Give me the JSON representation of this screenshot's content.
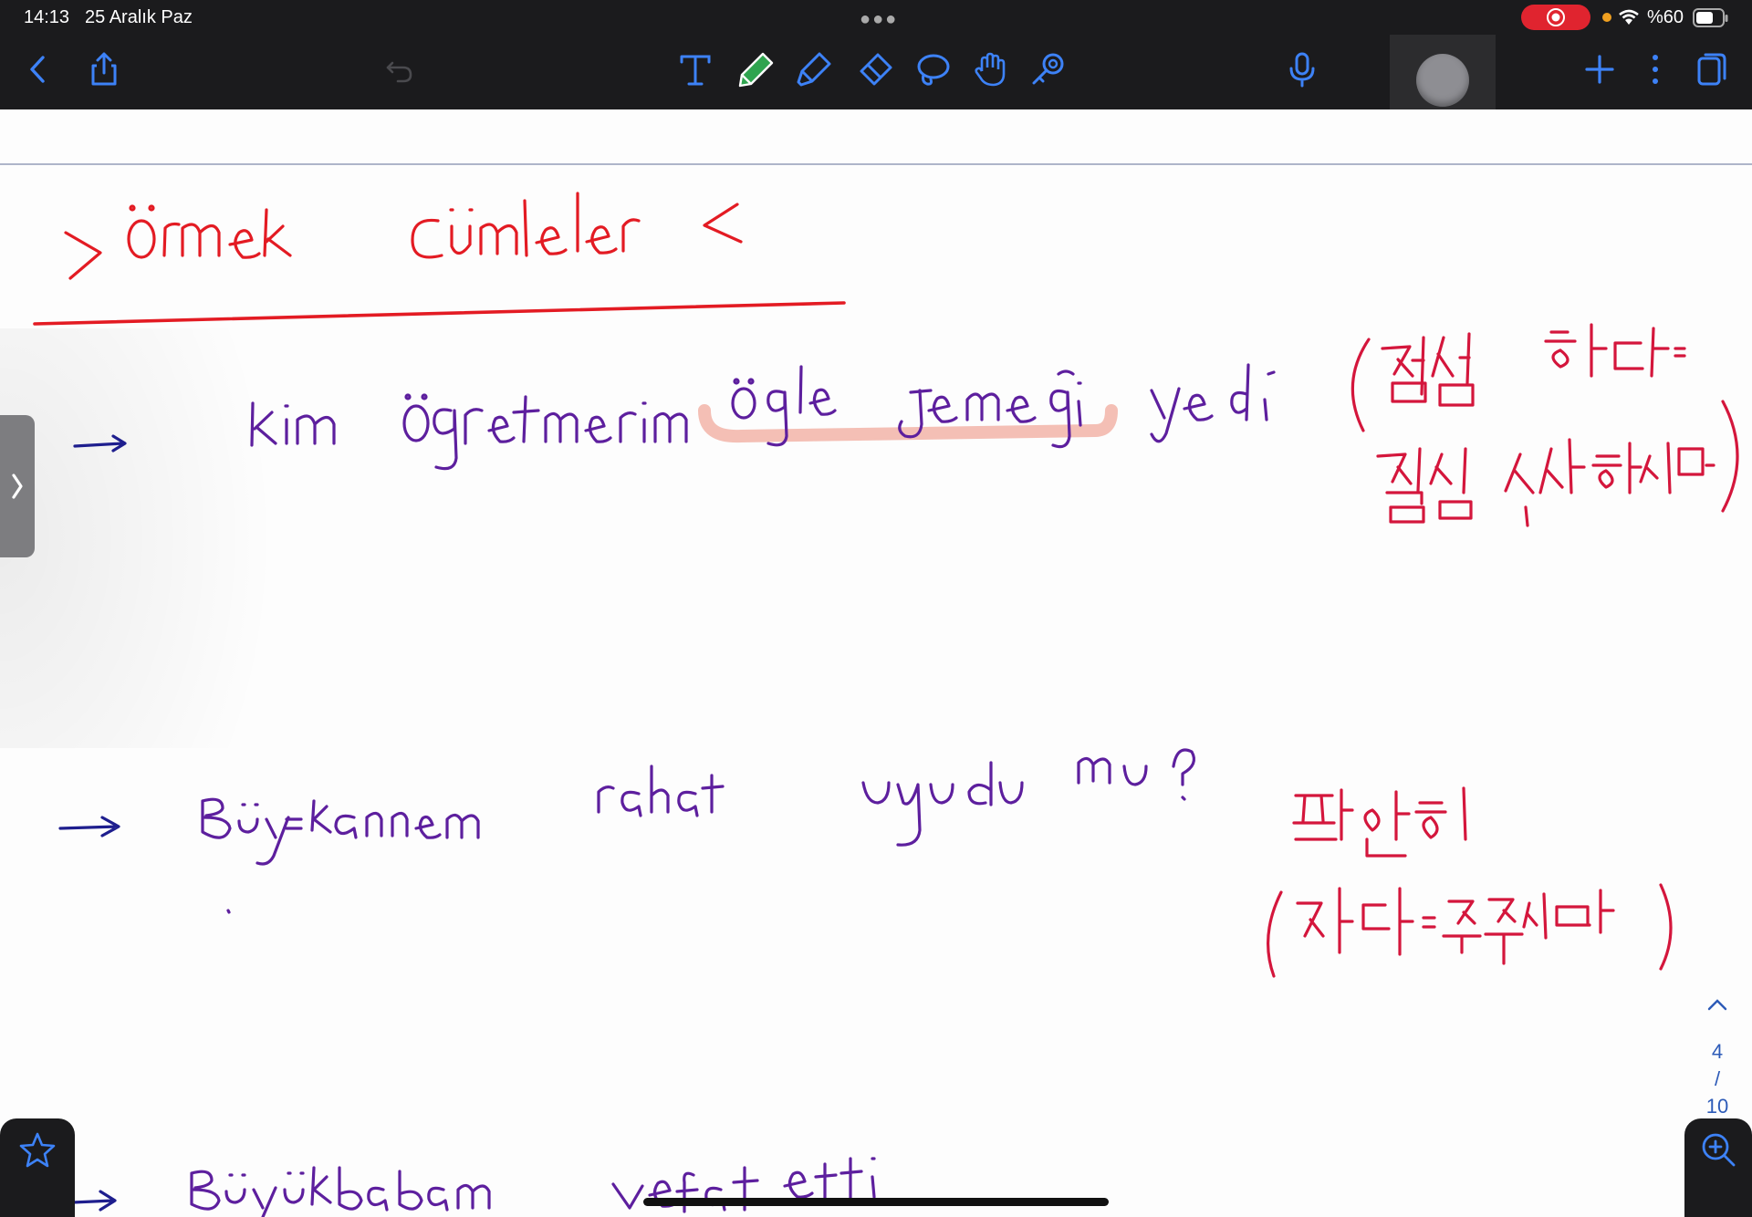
{
  "status_bar": {
    "time": "14:13",
    "date": "25 Aralık Paz",
    "battery_text": "%60",
    "record_color": "#e0242f"
  },
  "toolbar": {
    "icons": [
      "back-icon",
      "share-icon",
      "undo-icon",
      "text-tool-icon",
      "pen-tool-icon",
      "highlighter-tool-icon",
      "eraser-tool-icon",
      "lasso-tool-icon",
      "hand-tool-icon",
      "laser-pointer-icon",
      "microphone-icon",
      "record-button",
      "add-icon",
      "more-icon",
      "pages-icon"
    ],
    "active_tool_color": "#2fa44f"
  },
  "note": {
    "title": "> örnek cümleler <",
    "line1": {
      "text": "→ kim öğretmenim öğle yemeği yedi",
      "note": "(점심 하다= 점심 식사하시다)",
      "highlight_words": "öğle yemeği"
    },
    "line2": {
      "text": "→ Büyükannem rahat uyudu mu?",
      "note": "편안히 (자다=주무시다)"
    },
    "line3": {
      "text": "→ Büyükbabam vefat etti."
    }
  },
  "page_nav": {
    "current": "4",
    "separator": "/",
    "total": "10"
  },
  "ink_colors": {
    "red": "#e31b23",
    "purple": "#5d1f9e",
    "navy": "#1e1e8e",
    "crimson": "#d4163c",
    "highlight": "#f3b8ad"
  }
}
